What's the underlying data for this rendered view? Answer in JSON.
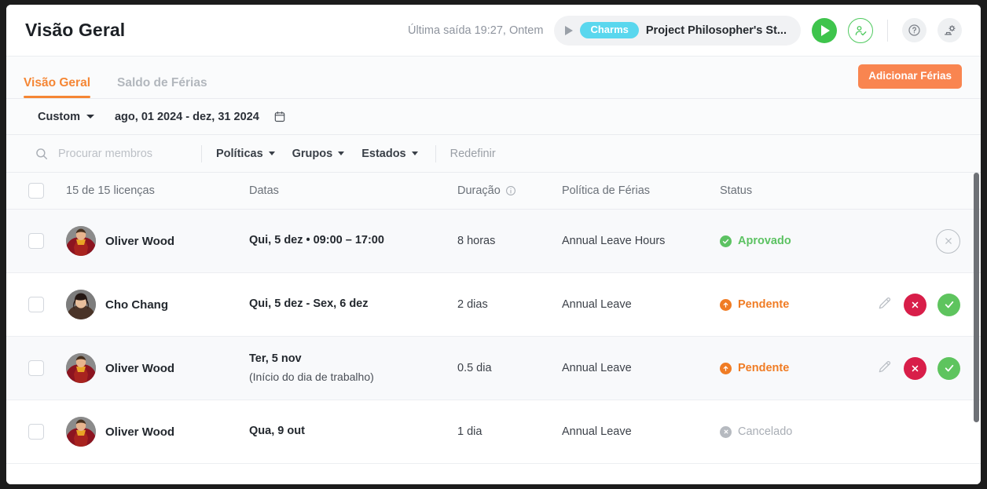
{
  "header": {
    "title": "Visão Geral",
    "last_exit": "Última saída 19:27, Ontem",
    "timer": {
      "play_icon": "play-icon",
      "tag": "Charms",
      "project": "Project Philosopher's St..."
    },
    "start_timer_label": "start-timer",
    "person_check_label": "person-check",
    "help_label": "help",
    "settings_label": "settings"
  },
  "tabs": {
    "items": [
      {
        "label": "Visão Geral",
        "active": true
      },
      {
        "label": "Saldo de Férias",
        "active": false
      }
    ],
    "add_button": "Adicionar Férias"
  },
  "range": {
    "preset": "Custom",
    "value": "ago, 01 2024 - dez, 31 2024",
    "calendar_icon": "calendar-icon"
  },
  "filters": {
    "search_placeholder": "Procurar membros",
    "search_value": "",
    "dropdowns": [
      "Políticas",
      "Grupos",
      "Estados"
    ],
    "reset": "Redefinir"
  },
  "table": {
    "columns": {
      "licenses": "15 de 15 licenças",
      "dates": "Datas",
      "duration": "Duração",
      "policy": "Política de Férias",
      "status": "Status"
    },
    "rows": [
      {
        "member": "Oliver Wood",
        "avatar": "oliver-wood-avatar",
        "dates": "Qui, 5 dez • 09:00 – 17:00",
        "dates_sub": "",
        "duration": "8 horas",
        "policy": "Annual Leave Hours",
        "status": "Aprovado",
        "status_kind": "approved",
        "actions": [
          "cancel-outline"
        ]
      },
      {
        "member": "Cho Chang",
        "avatar": "cho-chang-avatar",
        "dates": "Qui, 5 dez - Sex, 6 dez",
        "dates_sub": "",
        "duration": "2 dias",
        "policy": "Annual Leave",
        "status": "Pendente",
        "status_kind": "pending",
        "actions": [
          "edit",
          "reject",
          "approve"
        ]
      },
      {
        "member": "Oliver Wood",
        "avatar": "oliver-wood-avatar",
        "dates": "Ter, 5 nov",
        "dates_sub": "(Início do dia de trabalho)",
        "duration": "0.5 dia",
        "policy": "Annual Leave",
        "status": "Pendente",
        "status_kind": "pending",
        "actions": [
          "edit",
          "reject",
          "approve"
        ]
      },
      {
        "member": "Oliver Wood",
        "avatar": "oliver-wood-avatar",
        "dates": "Qua, 9 out",
        "dates_sub": "",
        "duration": "1 dia",
        "policy": "Annual Leave",
        "status": "Cancelado",
        "status_kind": "cancelled",
        "actions": []
      }
    ]
  },
  "colors": {
    "accent": "#f58634",
    "add_button": "#f98550",
    "approved": "#5cc262",
    "pending": "#f07c24",
    "cancelled": "#a9aeb5",
    "reject": "#d81e49",
    "approve": "#5ec45e",
    "charms_tag": "#5ad7ee",
    "play": "#3ec44c"
  }
}
